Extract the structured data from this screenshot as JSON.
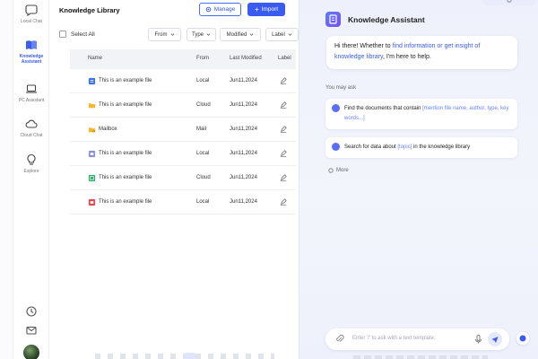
{
  "rail": {
    "items": [
      {
        "label": "Local Chat",
        "icon": "chat-bubble-icon"
      },
      {
        "label": "Knowledge\nAssistant",
        "icon": "book-icon",
        "active": true
      },
      {
        "label": "PC Assistant",
        "icon": "laptop-icon"
      },
      {
        "label": "Cloud Chat",
        "icon": "cloud-icon"
      },
      {
        "label": "Explore",
        "icon": "lightbulb-icon"
      }
    ],
    "bottom_icons": [
      "history-icon",
      "mail-icon"
    ]
  },
  "library": {
    "title": "Knowledge Library",
    "manage_label": "Manage",
    "import_label": "Import",
    "select_all": "Select All",
    "filters": [
      "From",
      "Type",
      "Modified",
      "Label"
    ],
    "columns": {
      "name": "Name",
      "from": "From",
      "modified": "Last Modified",
      "label": "Label"
    },
    "rows": [
      {
        "name": "This is an example file",
        "from": "Local",
        "modified": "Jun11,2024",
        "icon": "word-file-icon"
      },
      {
        "name": "This is an example file",
        "from": "Cloud",
        "modified": "Jun11,2024",
        "icon": "folder-icon"
      },
      {
        "name": "Mailbox",
        "from": "Mail",
        "modified": "Jun11,2024",
        "icon": "mailbox-folder-icon"
      },
      {
        "name": "This is an example file",
        "from": "Local",
        "modified": "Jun11,2024",
        "icon": "slides-file-icon"
      },
      {
        "name": "This is an example file",
        "from": "Cloud",
        "modified": "Jun11,2024",
        "icon": "sheet-file-icon"
      },
      {
        "name": "This is an example file",
        "from": "Local",
        "modified": "Jun11,2024",
        "icon": "pdf-file-icon"
      }
    ]
  },
  "assistant": {
    "title": "Knowledge Assistant",
    "greeting_pre": "Hi there! Whether to ",
    "greeting_link": "find information or get insight of knowledge library",
    "greeting_post": ", I'm here to help.",
    "you_may_ask": "You may ask",
    "suggestions": [
      {
        "pre": "Find the documents that contain ",
        "ph": "[mention file name, author, type, key words...]",
        "post": ""
      },
      {
        "pre": "Search for data about ",
        "ph": "[topic]",
        "post": " in the knowledge library"
      }
    ],
    "more": "More",
    "input_placeholder": "Enter '/' to ask with a text template."
  },
  "colors": {
    "accent": "#3a5bf0",
    "panel_bg": "#eef1fb"
  }
}
